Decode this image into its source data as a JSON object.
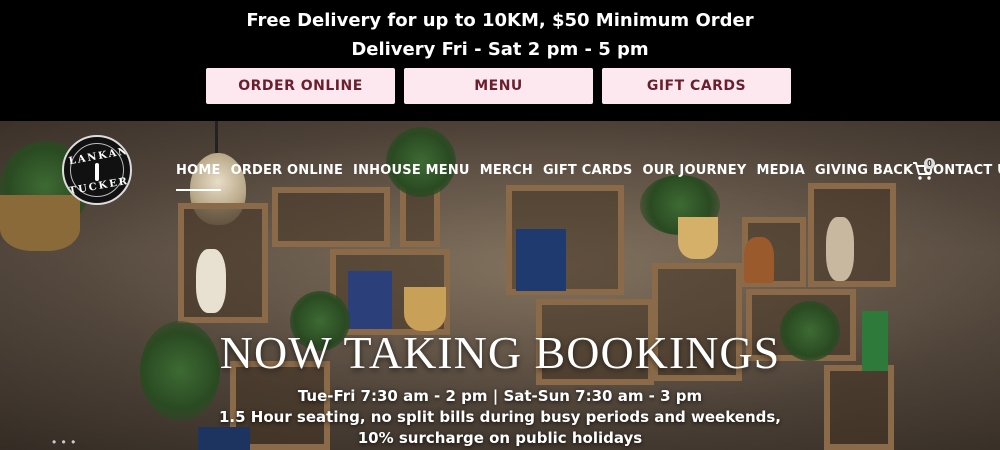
{
  "announcement": {
    "line1": "Free Delivery for up to 10KM, $50 Minimum Order",
    "line2": "Delivery Fri - Sat 2 pm - 5 pm"
  },
  "top_buttons": {
    "order_online": "ORDER ONLINE",
    "menu": "MENU",
    "gift_cards": "GIFT CARDS"
  },
  "logo": {
    "top_word": "LANKAN",
    "bottom_word": "TUCKER"
  },
  "nav": {
    "items": [
      "HOME",
      "ORDER ONLINE",
      "INHOUSE MENU",
      "MERCH",
      "GIFT CARDS",
      "OUR JOURNEY",
      "MEDIA",
      "GIVING BACK",
      "CONTACT US"
    ],
    "active": "HOME",
    "cart_count": "0"
  },
  "hero": {
    "headline": "NOW TAKING BOOKINGS",
    "hours": "Tue-Fri 7:30 am - 2 pm | Sat-Sun 7:30 am - 3 pm",
    "seating_note": "1.5 Hour seating, no split bills during busy periods and weekends,",
    "surcharge_note": "10% surcharge on public holidays"
  },
  "colors": {
    "topbar_bg": "#000000",
    "button_bg": "#fde8ef",
    "button_text": "#6b1f2e"
  }
}
